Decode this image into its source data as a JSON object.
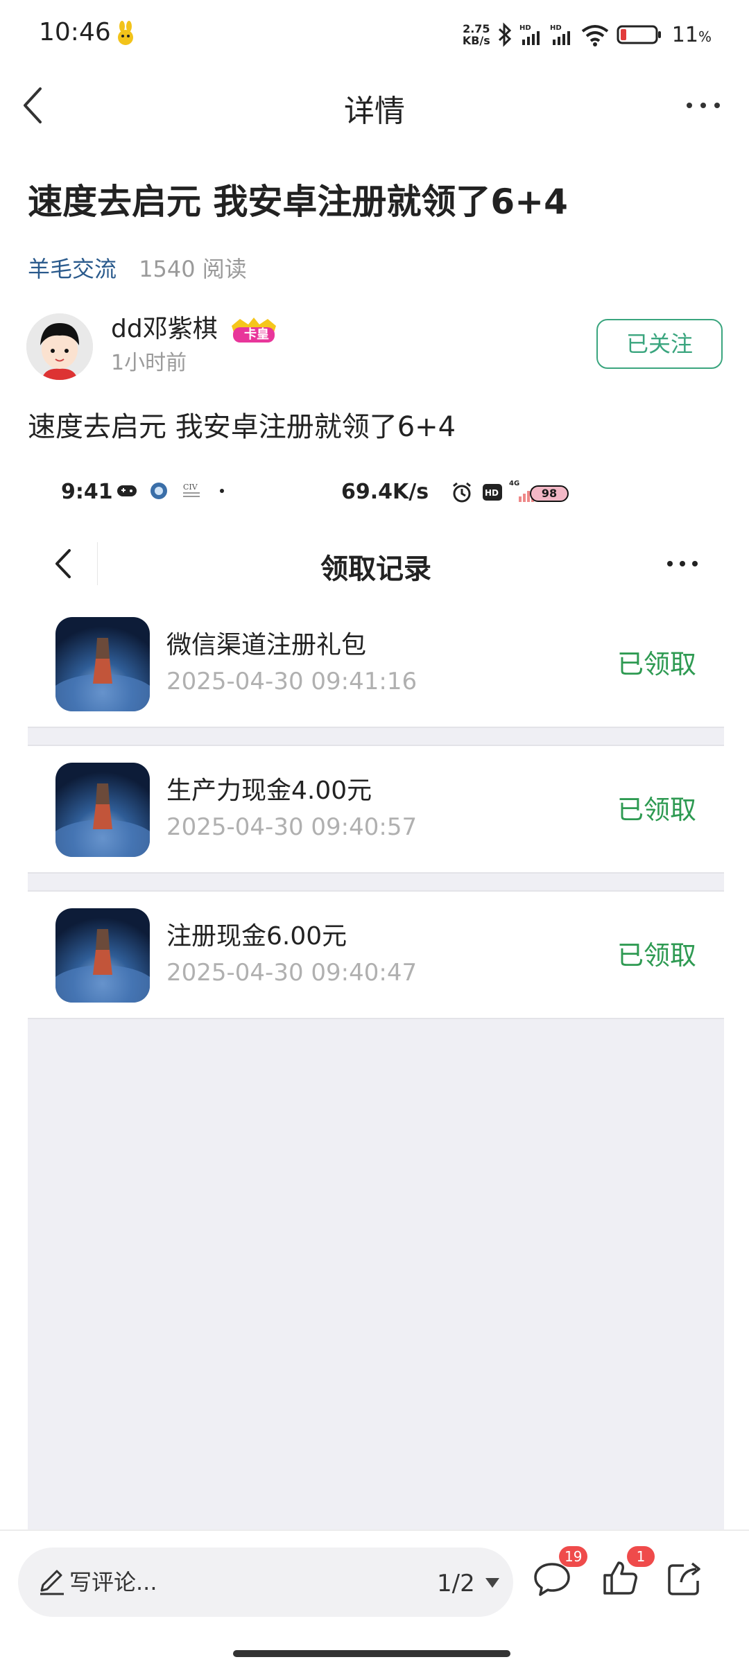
{
  "status_bar": {
    "time": "10:46",
    "net_speed_value": "2.75",
    "net_speed_unit": "KB/s",
    "sim_label": "HD",
    "battery_percent": "11",
    "battery_unit": "%"
  },
  "nav": {
    "title": "详情"
  },
  "post": {
    "title": "速度去启元 我安卓注册就领了6+4",
    "category": "羊毛交流",
    "reads": "1540 阅读",
    "author": "dd邓紫棋",
    "author_badge": "卡皇",
    "time": "1小时前",
    "follow_label": "已关注",
    "body": "速度去启元 我安卓注册就领了6+4"
  },
  "screenshot": {
    "status_time": "9:41",
    "status_speed": "69.4K/s",
    "status_battery": "98",
    "title": "领取记录",
    "records": [
      {
        "title": "微信渠道注册礼包",
        "date": "2025-04-30 09:41:16",
        "status": "已领取"
      },
      {
        "title": "生产力现金4.00元",
        "date": "2025-04-30 09:40:57",
        "status": "已领取"
      },
      {
        "title": "注册现金6.00元",
        "date": "2025-04-30 09:40:47",
        "status": "已领取"
      }
    ]
  },
  "bottom": {
    "comment_placeholder": "写评论...",
    "page_indicator": "1/2",
    "comment_count": "19",
    "like_count": "1"
  },
  "colors": {
    "accent_green": "#3aa57e",
    "claimed_green": "#2e9a52",
    "category_blue": "#2a5a8c",
    "badge_red": "#ef4b4b"
  },
  "icons": [
    "back-arrow-icon",
    "more-icon",
    "pencil-icon",
    "comment-icon",
    "like-icon",
    "share-icon",
    "wifi-icon",
    "bluetooth-icon",
    "signal-icon",
    "battery-icon"
  ]
}
